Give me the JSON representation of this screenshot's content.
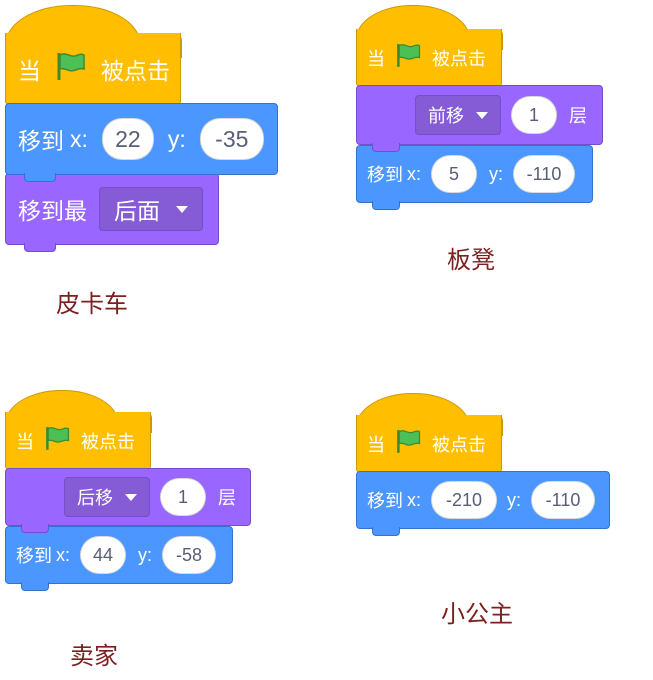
{
  "colors": {
    "events": "#FFBF00",
    "motion": "#4C97FF",
    "looks": "#9966FF",
    "caption": "#7B1F1F"
  },
  "scripts": [
    {
      "caption": "皮卡车",
      "hat": {
        "when": "当",
        "clicked": "被点击",
        "icon": "green-flag-icon"
      },
      "goto": {
        "label": "移到",
        "x_label": "x:",
        "x": "22",
        "y_label": "y:",
        "y": "-35"
      },
      "layer": {
        "label": "移到最",
        "dropdown": "后面"
      }
    },
    {
      "caption": "板凳",
      "hat": {
        "when": "当",
        "clicked": "被点击",
        "icon": "green-flag-icon"
      },
      "layer": {
        "dropdown": "前移",
        "count": "1",
        "suffix": "层"
      },
      "goto": {
        "label": "移到",
        "x_label": "x:",
        "x": "5",
        "y_label": "y:",
        "y": "-110"
      }
    },
    {
      "caption": "卖家",
      "hat": {
        "when": "当",
        "clicked": "被点击",
        "icon": "green-flag-icon"
      },
      "layer": {
        "dropdown": "后移",
        "count": "1",
        "suffix": "层"
      },
      "goto": {
        "label": "移到",
        "x_label": "x:",
        "x": "44",
        "y_label": "y:",
        "y": "-58"
      }
    },
    {
      "caption": "小公主",
      "hat": {
        "when": "当",
        "clicked": "被点击",
        "icon": "green-flag-icon"
      },
      "goto": {
        "label": "移到",
        "x_label": "x:",
        "x": "-210",
        "y_label": "y:",
        "y": "-110"
      }
    }
  ]
}
